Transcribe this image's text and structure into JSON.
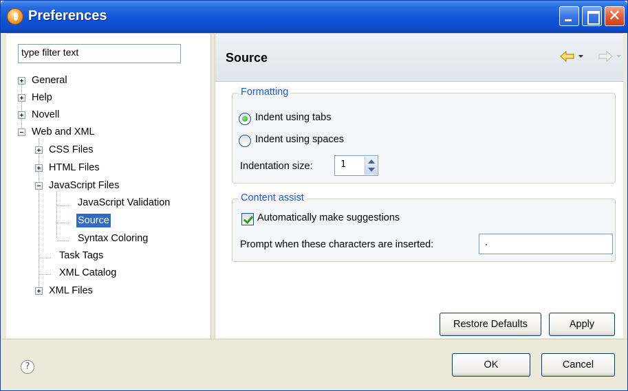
{
  "window": {
    "title": "Preferences",
    "close_glyph": "✕"
  },
  "filter": {
    "value": "type filter text"
  },
  "tree": {
    "items": [
      {
        "label": "General",
        "expander": "plus"
      },
      {
        "label": "Help",
        "expander": "plus"
      },
      {
        "label": "Novell",
        "expander": "plus"
      },
      {
        "label": "Web and XML",
        "expander": "minus"
      },
      {
        "label": "CSS Files",
        "expander": "plus"
      },
      {
        "label": "HTML Files",
        "expander": "plus"
      },
      {
        "label": "JavaScript Files",
        "expander": "minus"
      },
      {
        "label": "JavaScript Validation",
        "expander": "none"
      },
      {
        "label": "Source",
        "expander": "none",
        "selected": true
      },
      {
        "label": "Syntax Coloring",
        "expander": "none"
      },
      {
        "label": "Task Tags",
        "expander": "none"
      },
      {
        "label": "XML Catalog",
        "expander": "none"
      },
      {
        "label": "XML Files",
        "expander": "plus"
      }
    ]
  },
  "page": {
    "title": "Source",
    "back_icon": "back-arrow-icon",
    "forward_icon": "forward-arrow-icon"
  },
  "formatting": {
    "title": "Formatting",
    "radio_tabs": "Indent using tabs",
    "radio_spaces": "Indent using spaces",
    "selected": "tabs",
    "indent_label": "Indentation size:",
    "indent_value": "1"
  },
  "content_assist": {
    "title": "Content assist",
    "auto_label": "Automatically make suggestions",
    "auto_checked": true,
    "prompt_label": "Prompt when these characters are inserted:",
    "prompt_value": "."
  },
  "buttons": {
    "restore": "Restore Defaults",
    "apply": "Apply",
    "ok": "OK",
    "cancel": "Cancel",
    "help_icon": "?"
  },
  "colors": {
    "titlebar": "#0f4ccc",
    "selection": "#316ac5",
    "group_title": "#1e5ad1"
  }
}
